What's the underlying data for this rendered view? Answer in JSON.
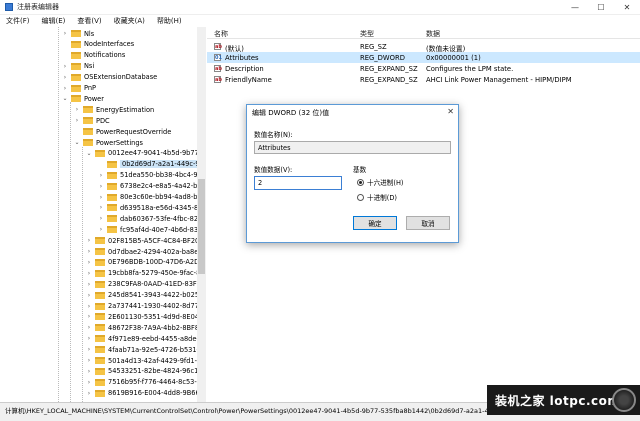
{
  "window": {
    "title": "注册表编辑器",
    "controls": [
      "—",
      "☐",
      "✕"
    ]
  },
  "menu": [
    "文件(F)",
    "编辑(E)",
    "查看(V)",
    "收藏夹(A)",
    "帮助(H)"
  ],
  "tree": [
    {
      "label": "Nls",
      "indent": 0,
      "chevron": "›"
    },
    {
      "label": "NodeInterfaces",
      "indent": 0,
      "chevron": ""
    },
    {
      "label": "Notifications",
      "indent": 0,
      "chevron": ""
    },
    {
      "label": "Nsi",
      "indent": 0,
      "chevron": "›"
    },
    {
      "label": "OSExtensionDatabase",
      "indent": 0,
      "chevron": "›"
    },
    {
      "label": "PnP",
      "indent": 0,
      "chevron": "›"
    },
    {
      "label": "Power",
      "indent": 0,
      "chevron": "⌄"
    },
    {
      "label": "EnergyEstimation",
      "indent": 1,
      "chevron": "›"
    },
    {
      "label": "PDC",
      "indent": 1,
      "chevron": "›"
    },
    {
      "label": "PowerRequestOverride",
      "indent": 1,
      "chevron": ""
    },
    {
      "label": "PowerSettings",
      "indent": 1,
      "chevron": "⌄"
    },
    {
      "label": "0012ee47-9041-4b5d-9b77-53",
      "indent": 2,
      "chevron": "⌄"
    },
    {
      "label": "0b2d69d7-a2a1-449c-9680",
      "indent": 3,
      "chevron": "",
      "selected": true
    },
    {
      "label": "51dea550-bb38-4bc4-991b",
      "indent": 3,
      "chevron": "›"
    },
    {
      "label": "6738e2c4-e8a5-4a42-b16a",
      "indent": 3,
      "chevron": "›"
    },
    {
      "label": "80e3c60e-bb94-4ad8-bbe0",
      "indent": 3,
      "chevron": "›"
    },
    {
      "label": "d639518a-e56d-4345-8af2",
      "indent": 3,
      "chevron": "›"
    },
    {
      "label": "dab60367-53fe-4fbc-825e-",
      "indent": 3,
      "chevron": "›"
    },
    {
      "label": "fc95af4d-40e7-4b6d-835a-",
      "indent": 3,
      "chevron": "›"
    },
    {
      "label": "02F815B5-A5CF-4C84-BF20-64",
      "indent": 2,
      "chevron": "›"
    },
    {
      "label": "0d7dbae2-4294-402a-ba8e-26",
      "indent": 2,
      "chevron": "›"
    },
    {
      "label": "0E796BDB-100D-47D6-A2D5-F",
      "indent": 2,
      "chevron": "›"
    },
    {
      "label": "19cbb8fa-5279-450e-9fac-8a3",
      "indent": 2,
      "chevron": "›"
    },
    {
      "label": "238C9FA8-0AAD-41ED-83F4-97",
      "indent": 2,
      "chevron": "›"
    },
    {
      "label": "245d8541-3943-4422-b025-13",
      "indent": 2,
      "chevron": "›"
    },
    {
      "label": "2a737441-1930-4402-8d77-b2",
      "indent": 2,
      "chevron": "›"
    },
    {
      "label": "2E601130-5351-4d9d-8E04-25",
      "indent": 2,
      "chevron": "›"
    },
    {
      "label": "48672F38-7A9A-4bb2-8BF8-3D",
      "indent": 2,
      "chevron": "›"
    },
    {
      "label": "4f971e89-eebd-4455-a8de-9e5",
      "indent": 2,
      "chevron": "›"
    },
    {
      "label": "4faab71a-92e5-4726-b531-224",
      "indent": 2,
      "chevron": "›"
    },
    {
      "label": "501a4d13-42af-4429-9fd1-a82",
      "indent": 2,
      "chevron": "›"
    },
    {
      "label": "54533251-82be-4824-96c1-47E",
      "indent": 2,
      "chevron": "›"
    },
    {
      "label": "7516b95f-f776-4464-8c53-061",
      "indent": 2,
      "chevron": "›"
    },
    {
      "label": "8619B916-E004-4dd8-9B66-DA",
      "indent": 2,
      "chevron": "›"
    }
  ],
  "list": {
    "headers": {
      "name": "名称",
      "type": "类型",
      "data": "数据"
    },
    "rows": [
      {
        "icon": "ab",
        "name": "(默认)",
        "type": "REG_SZ",
        "data": "(数值未设置)"
      },
      {
        "icon": "bin",
        "name": "Attributes",
        "type": "REG_DWORD",
        "data": "0x00000001 (1)",
        "selected": true
      },
      {
        "icon": "ab",
        "name": "Description",
        "type": "REG_EXPAND_SZ",
        "data": "Configures the LPM state."
      },
      {
        "icon": "ab",
        "name": "FriendlyName",
        "type": "REG_EXPAND_SZ",
        "data": "AHCI Link Power Management - HIPM/DIPM"
      }
    ]
  },
  "dialog": {
    "title": "编辑 DWORD (32 位)值",
    "close": "✕",
    "value_name_label": "数值名称(N):",
    "value_name": "Attributes",
    "value_data_label": "数值数据(V):",
    "value_data": "2",
    "base_label": "基数",
    "radio_hex": "十六进制(H)",
    "radio_dec": "十进制(D)",
    "ok": "确定",
    "cancel": "取消"
  },
  "status": "计算机\\HKEY_LOCAL_MACHINE\\SYSTEM\\CurrentControlSet\\Control\\Power\\PowerSettings\\0012ee47-9041-4b5d-9b77-535fba8b1442\\0b2d69d7-a2a1-4",
  "watermark": "装机之家 lotpc.com"
}
